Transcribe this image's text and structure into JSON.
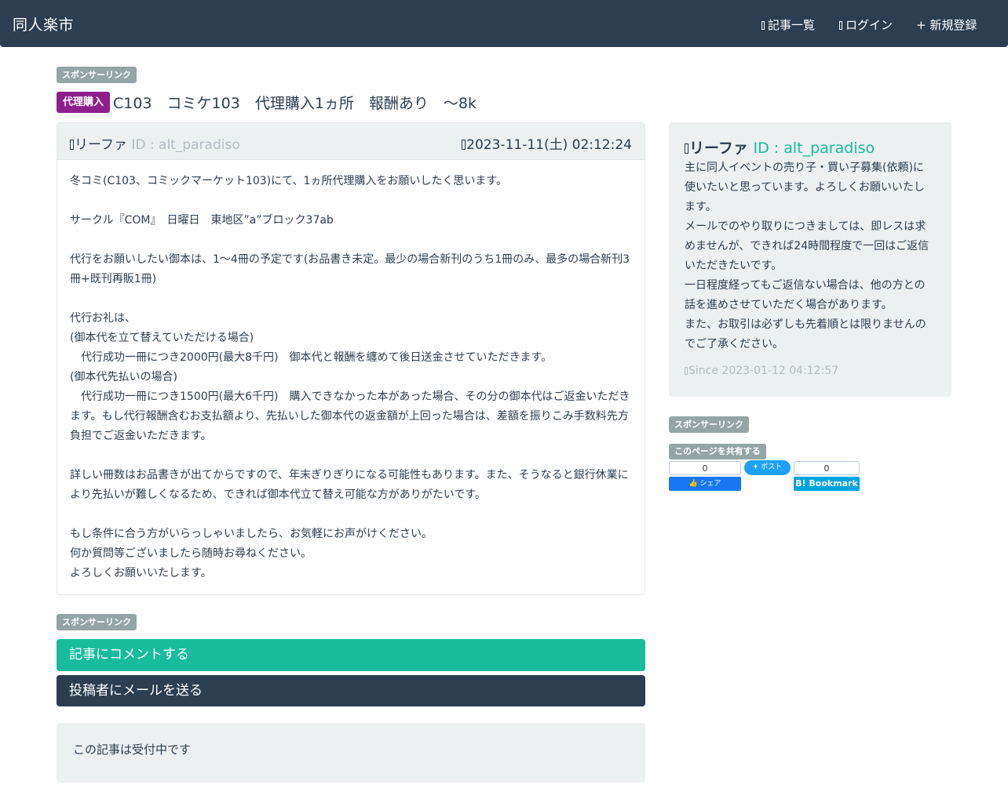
{
  "navbar": {
    "brand": "同人楽市",
    "links": [
      {
        "icon": "document-icon",
        "label": "記事一覧"
      },
      {
        "icon": "login-icon",
        "label": "ログイン"
      },
      {
        "icon": "plus-icon",
        "label": "+ 新規登録"
      }
    ]
  },
  "sponsor_label": "スポンサーリンク",
  "post": {
    "category_badge": "代理購入",
    "title": "C103　コミケ103　代理購入1ヵ所　報酬あり　～8k",
    "author_name": "リーファ",
    "author_id": "ID : alt_paradiso",
    "date": "2023-11-11(土) 02:12:24",
    "body": [
      "冬コミ(C103、コミックマーケット103)にて、1ヵ所代理購入をお願いしたく思います。",
      "",
      "サークル『COM』　日曜日　東地区”a”ブロック37ab",
      "",
      "代行をお願いしたい御本は、1～4冊の予定です(お品書き未定。最少の場合新刊のうち1冊のみ、最多の場合新刊3冊+既刊再販1冊)",
      "",
      "代行お礼は、",
      "(御本代を立て替えていただける場合)",
      "　代行成功一冊につき2000円(最大8千円)　御本代と報酬を纏めて後日送金させていただきます。",
      "(御本代先払いの場合)",
      "　代行成功一冊につき1500円(最大6千円)　購入できなかった本があった場合、その分の御本代はご返金いただきます。もし代行報酬含むお支払額より、先払いした御本代の返金額が上回った場合は、差額を振りこみ手数料先方負担でご返金いただきます。",
      "",
      "詳しい冊数はお品書きが出てからですので、年末ぎりぎりになる可能性もあります。また、そうなると銀行休業により先払いが難しくなるため、できれば御本代立て替え可能な方がありがたいです。",
      "",
      "もし条件に合う方がいらっしゃいましたら、お気軽にお声がけください。",
      "何か質問等ございましたら随時お尋ねください。",
      "よろしくお願いいたします。"
    ]
  },
  "actions": {
    "comment_button": "記事にコメントする",
    "mail_button": "投稿者にメールを送る",
    "status": "この記事は受付中です"
  },
  "profile": {
    "name": "リーファ",
    "id": "ID : alt_paradiso",
    "description": "主に同人イベントの売り子・買い子募集(依頼)に使いたいと思っています。よろしくお願いいたします。\nメールでのやり取りにつきましては、即レスは求めませんが、できれば24時間程度で一回はご返信いただきたいです。\n一日程度経ってもご返信ない場合は、他の方との話を進めさせていただく場合があります。\nまた、お取引は必ずしも先着順とは限りませんのでご了承ください。",
    "since": "Since 2023-01-12 04:12:57"
  },
  "share": {
    "label": "このページを共有する",
    "facebook_count": "0",
    "facebook_label": "シェア",
    "twitter_label": "ポスト",
    "hatena_count": "0",
    "hatena_label": "B! Bookmark"
  },
  "colors": {
    "navbar": "#2c3e50",
    "accent_green": "#18bc9c",
    "badge_purple": "#8e1e8b",
    "sponsor_gray": "#95a5a6",
    "panel_bg": "#ecf0f1"
  }
}
